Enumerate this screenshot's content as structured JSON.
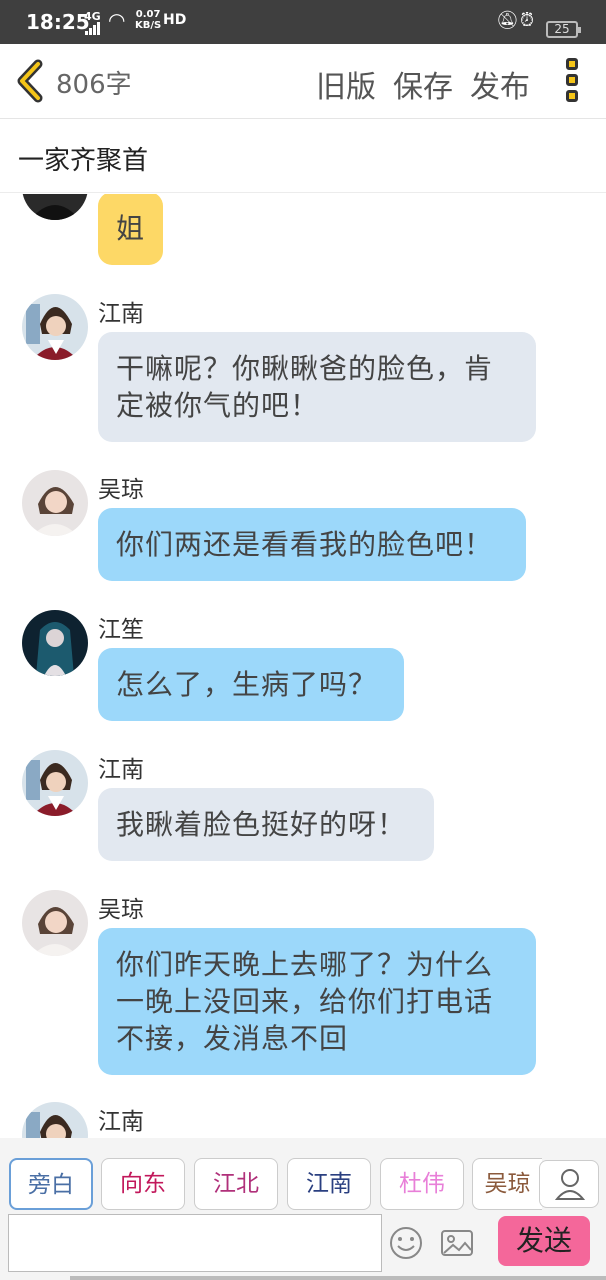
{
  "status_bar": {
    "time": "18:25",
    "network": "4G",
    "speed_value": "0.07",
    "speed_unit": "KB/S",
    "hd": "HD",
    "battery": "25"
  },
  "top_bar": {
    "word_count": "806字",
    "old_version": "旧版",
    "save": "保存",
    "publish": "发布"
  },
  "chat_title": "一家齐聚首",
  "messages": [
    {
      "sender": "",
      "text": "姐",
      "style": "yellow",
      "avatar": "dark-clothes-avatar"
    },
    {
      "sender": "江南",
      "text": "干嘛呢？你瞅瞅爸的脸色，肯定被你气的吧！",
      "style": "gray",
      "avatar": "jiangnan-avatar"
    },
    {
      "sender": "吴琼",
      "text": "你们两还是看看我的脸色吧！",
      "style": "blue",
      "avatar": "wuqiong-avatar"
    },
    {
      "sender": "江笙",
      "text": "怎么了，生病了吗？",
      "style": "blue",
      "avatar": "jiangsheng-avatar"
    },
    {
      "sender": "江南",
      "text": "我瞅着脸色挺好的呀！",
      "style": "gray",
      "avatar": "jiangnan-avatar"
    },
    {
      "sender": "吴琼",
      "text": "你们昨天晚上去哪了？为什么一晚上没回来，给你们打电话不接，发消息不回",
      "style": "blue",
      "avatar": "wuqiong-avatar"
    },
    {
      "sender": "江南",
      "text": "",
      "style": "gray",
      "avatar": "jiangnan-avatar"
    }
  ],
  "characters": [
    {
      "label": "旁白",
      "color": "#4a6fa5",
      "active": true
    },
    {
      "label": "向东",
      "color": "#c2185b",
      "active": false
    },
    {
      "label": "江北",
      "color": "#b0307a",
      "active": false
    },
    {
      "label": "江南",
      "color": "#2a3f80",
      "active": false
    },
    {
      "label": "杜伟",
      "color": "#e87fd8",
      "active": false
    },
    {
      "label": "吴琼",
      "color": "#8b5a3c",
      "active": false
    }
  ],
  "send_label": "发送",
  "colors": {
    "status_bg": "#3f3f3f",
    "accent_yellow": "#f5c518",
    "send_button": "#f4679a",
    "bubble_blue": "#9cd8fa",
    "bubble_gray": "#e2e8f0",
    "bubble_yellow": "#fdd866"
  }
}
